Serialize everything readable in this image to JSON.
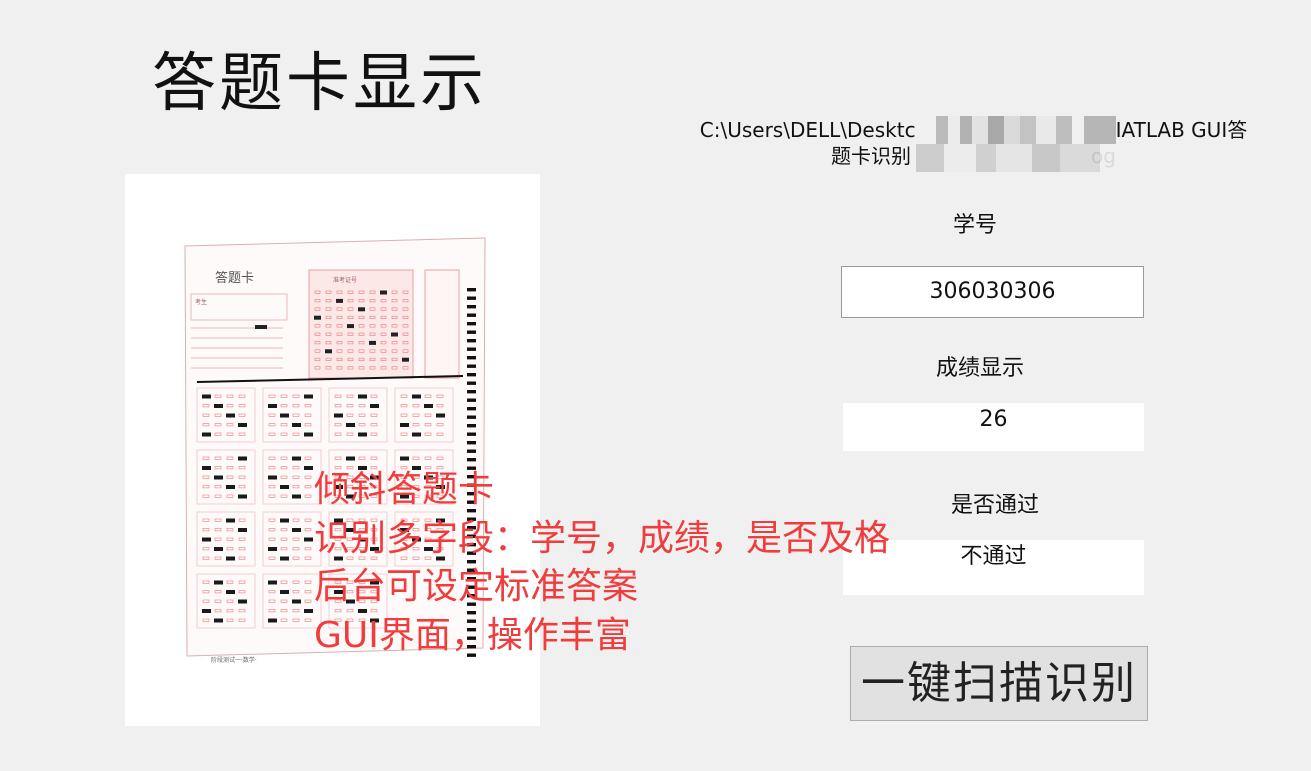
{
  "header": {
    "title": "答题卡显示"
  },
  "file_path": {
    "line1": "C:\\Users\\DELL\\Desktc",
    "line1_end": "IATLAB GUI答",
    "line2": "题卡识别",
    "line2_end": "og"
  },
  "student_id": {
    "label": "学号",
    "value": "306030306"
  },
  "score": {
    "label": "成绩显示",
    "value": "26"
  },
  "pass_status": {
    "label": "是否通过",
    "value": "不通过"
  },
  "scan_button": {
    "label": "一键扫描识别"
  },
  "overlay_notes": [
    "倾斜答题卡",
    "识别多字段：学号，成绩，是否及格",
    "后台可设定标准答案",
    "GUI界面，操作丰富"
  ],
  "answer_sheet": {
    "title": "答题卡",
    "field_exam": "考生",
    "field_id": "准考证号",
    "footer": "阶段测试一·数学·",
    "accent_color": "#e87a7a"
  }
}
